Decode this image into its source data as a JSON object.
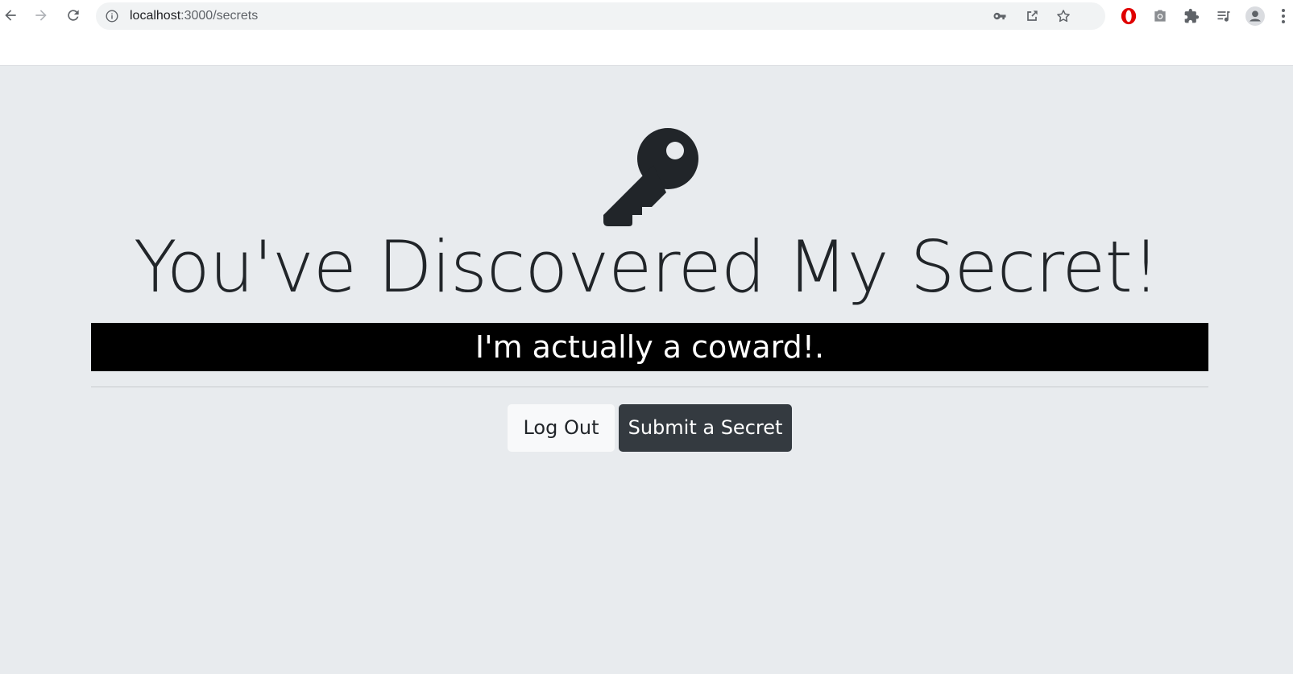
{
  "browser": {
    "url_host": "localhost",
    "url_path": ":3000/secrets"
  },
  "page": {
    "headline": "You've Discovered My Secret!",
    "secret_text": "I'm actually a coward!.",
    "logout_label": "Log Out",
    "submit_label": "Submit a Secret"
  },
  "colors": {
    "page_background": "#e8ebee",
    "secret_bar": "#000000",
    "submit_button": "#343a40",
    "logout_button": "#f8f9fa",
    "opera_icon": "#e00000"
  }
}
